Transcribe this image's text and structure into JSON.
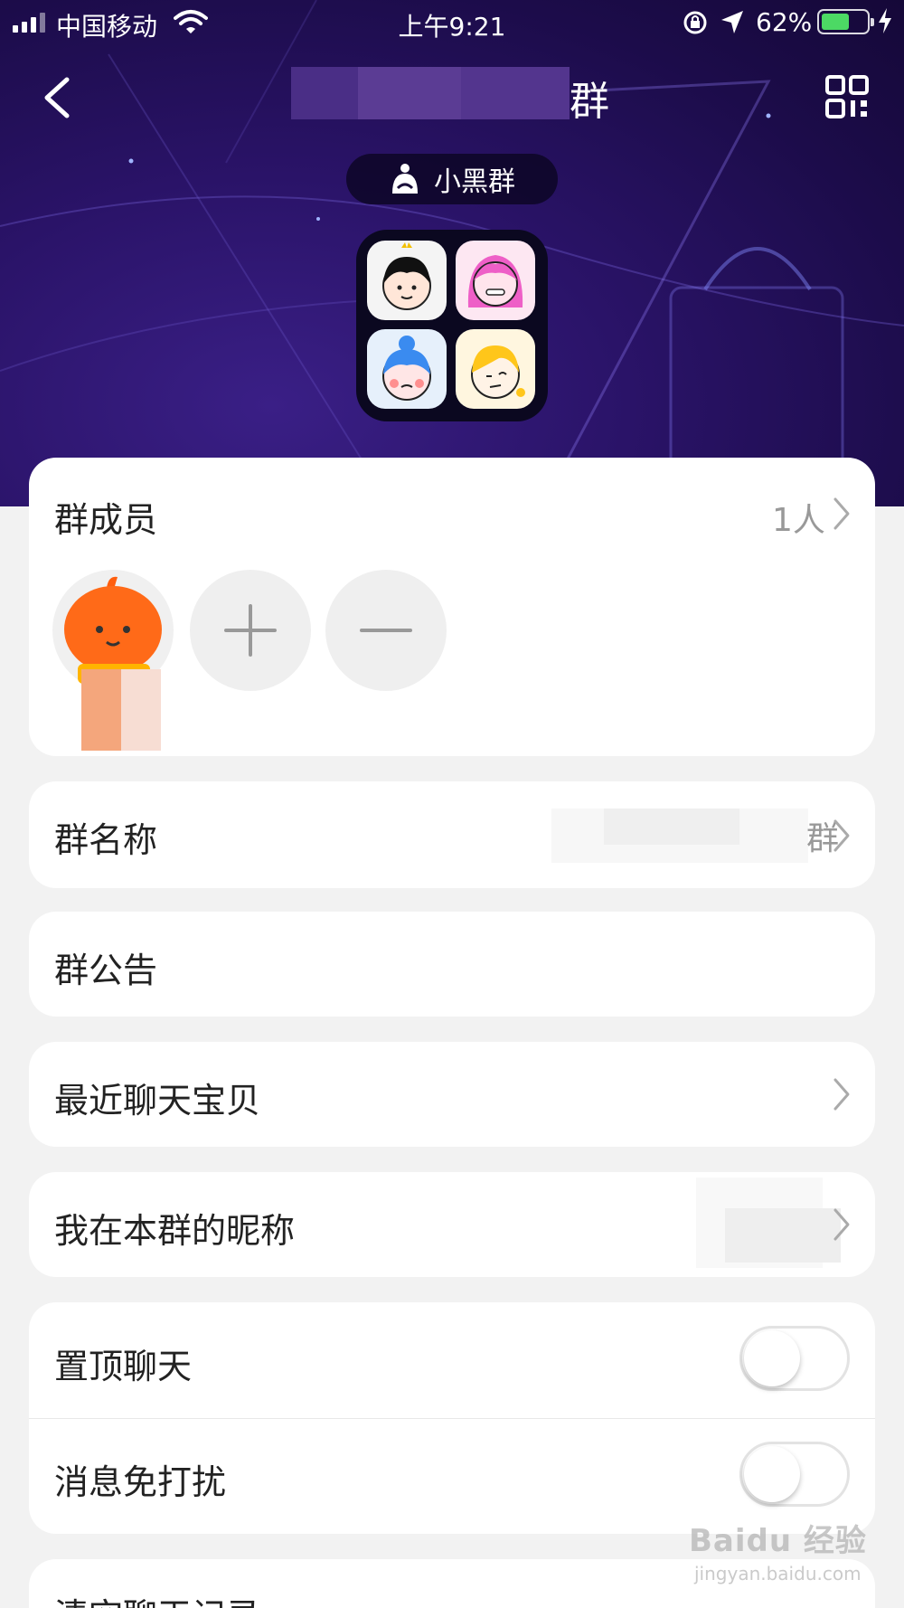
{
  "status_bar": {
    "carrier": "中国移动",
    "time": "上午9:21",
    "battery_percent": "62%",
    "battery_level": 0.62,
    "icons": [
      "signal-icon",
      "wifi-icon",
      "orientation-lock-icon",
      "location-icon",
      "battery-icon",
      "charging-icon"
    ]
  },
  "nav": {
    "title_suffix": "群",
    "icons": [
      "back-icon",
      "qrcode-icon"
    ]
  },
  "group_badge": {
    "label": "小黑群",
    "icon": "group-type-icon"
  },
  "members_section": {
    "title": "群成员",
    "count": "1人",
    "members": [
      {
        "avatar": "pumpkin-avatar"
      }
    ],
    "add_icon": "plus-icon",
    "remove_icon": "minus-icon"
  },
  "settings": {
    "group_name_label": "群名称",
    "group_name_value_suffix": "群",
    "announcement_label": "群公告",
    "recent_items_label": "最近聊天宝贝",
    "my_nickname_label": "我在本群的昵称",
    "pin_chat_label": "置顶聊天",
    "pin_chat_on": false,
    "mute_label": "消息免打扰",
    "mute_on": false,
    "clear_history_label": "清空聊天记录"
  },
  "watermark": {
    "brand": "Baidu 经验",
    "url": "jingyan.baidu.com"
  },
  "colors": {
    "header_bg": "#2a1368",
    "toggle_off_border": "#e3e3e3",
    "battery_fill": "#4cd964"
  }
}
